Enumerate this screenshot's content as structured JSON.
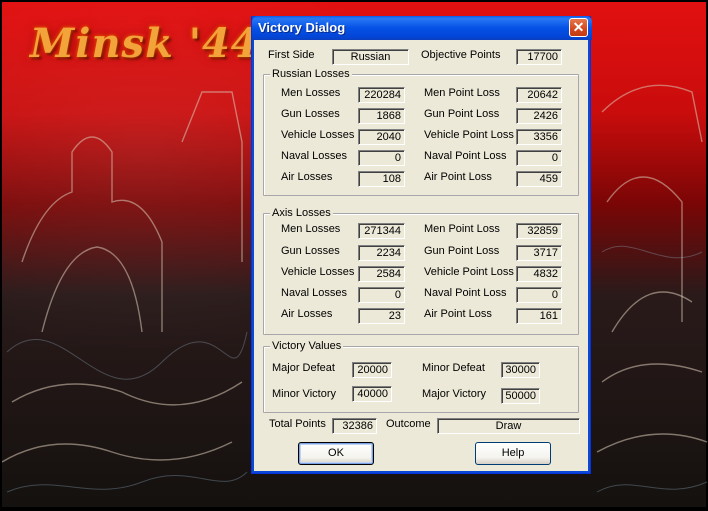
{
  "background": {
    "game_title": "Minsk '44"
  },
  "dialog": {
    "title": "Victory Dialog",
    "close_symbol": "✕",
    "first_side": {
      "label": "First Side",
      "value": "Russian"
    },
    "objective_points": {
      "label": "Objective Points",
      "value": "17700"
    },
    "russian_losses": {
      "title": "Russian Losses",
      "left": [
        {
          "label": "Men Losses",
          "value": "220284"
        },
        {
          "label": "Gun Losses",
          "value": "1868"
        },
        {
          "label": "Vehicle Losses",
          "value": "2040"
        },
        {
          "label": "Naval Losses",
          "value": "0"
        },
        {
          "label": "Air Losses",
          "value": "108"
        }
      ],
      "right": [
        {
          "label": "Men Point Loss",
          "value": "20642"
        },
        {
          "label": "Gun Point Loss",
          "value": "2426"
        },
        {
          "label": "Vehicle Point Loss",
          "value": "3356"
        },
        {
          "label": "Naval Point Loss",
          "value": "0"
        },
        {
          "label": "Air Point Loss",
          "value": "459"
        }
      ]
    },
    "axis_losses": {
      "title": "Axis Losses",
      "left": [
        {
          "label": "Men Losses",
          "value": "271344"
        },
        {
          "label": "Gun Losses",
          "value": "2234"
        },
        {
          "label": "Vehicle Losses",
          "value": "2584"
        },
        {
          "label": "Naval Losses",
          "value": "0"
        },
        {
          "label": "Air Losses",
          "value": "23"
        }
      ],
      "right": [
        {
          "label": "Men Point Loss",
          "value": "32859"
        },
        {
          "label": "Gun Point Loss",
          "value": "3717"
        },
        {
          "label": "Vehicle Point Loss",
          "value": "4832"
        },
        {
          "label": "Naval Point Loss",
          "value": "0"
        },
        {
          "label": "Air Point Loss",
          "value": "161"
        }
      ]
    },
    "victory_values": {
      "title": "Victory Values",
      "major_defeat": {
        "label": "Major Defeat",
        "value": "20000"
      },
      "minor_defeat": {
        "label": "Minor Defeat",
        "value": "30000"
      },
      "minor_victory": {
        "label": "Minor Victory",
        "value": "40000"
      },
      "major_victory": {
        "label": "Major Victory",
        "value": "50000"
      }
    },
    "total_points": {
      "label": "Total Points",
      "value": "32386"
    },
    "outcome": {
      "label": "Outcome",
      "value": "Draw"
    },
    "ok_label": "OK",
    "help_label": "Help"
  }
}
